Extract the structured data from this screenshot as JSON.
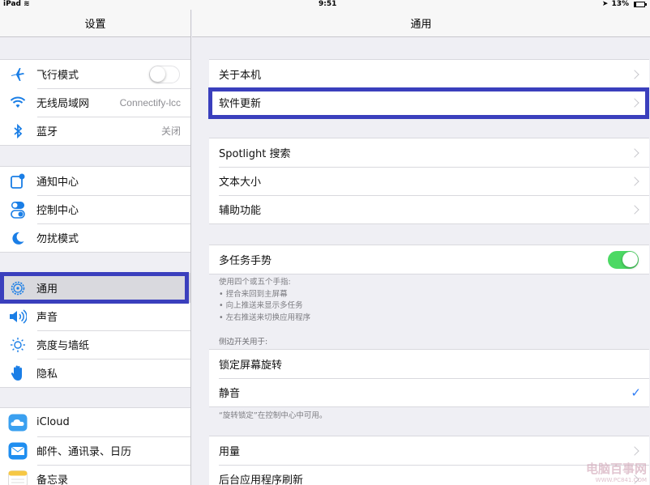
{
  "status_bar": {
    "device": "iPad",
    "time": "9:51",
    "battery": "13%"
  },
  "left": {
    "title": "设置",
    "groups": [
      [
        {
          "label": "飞行模式",
          "icon": "airplane-icon",
          "toggle": false
        },
        {
          "label": "无线局域网",
          "icon": "wifi-icon",
          "value": "Connectify-lcc"
        },
        {
          "label": "蓝牙",
          "icon": "bluetooth-icon",
          "value": "关闭"
        }
      ],
      [
        {
          "label": "通知中心",
          "icon": "notification-center-icon"
        },
        {
          "label": "控制中心",
          "icon": "control-center-icon"
        },
        {
          "label": "勿扰模式",
          "icon": "moon-icon"
        }
      ],
      [
        {
          "label": "通用",
          "icon": "gear-icon",
          "selected": true
        },
        {
          "label": "声音",
          "icon": "speaker-icon"
        },
        {
          "label": "亮度与墙纸",
          "icon": "sun-icon"
        },
        {
          "label": "隐私",
          "icon": "hand-icon"
        }
      ],
      [
        {
          "label": "iCloud",
          "icon": "cloud-icon"
        },
        {
          "label": "邮件、通讯录、日历",
          "icon": "mail-icon"
        },
        {
          "label": "备忘录",
          "icon": "notes-icon"
        }
      ]
    ]
  },
  "right": {
    "title": "通用",
    "group1": [
      "关于本机",
      "软件更新"
    ],
    "group2": [
      "Spotlight 搜索",
      "文本大小",
      "辅助功能"
    ],
    "multitask": {
      "label": "多任务手势",
      "on": true
    },
    "multitask_footer": [
      "使用四个或五个手指:",
      "• 捏合来回到主屏幕",
      "• 向上推送来显示多任务",
      "• 左右推送来切换应用程序"
    ],
    "side_switch_header": "侧边开关用于:",
    "side_switch": [
      "锁定屏幕旋转",
      "静音"
    ],
    "side_switch_checked": "✓",
    "side_switch_footer": "“旋转锁定”在控制中心中可用。",
    "group4": [
      "用量",
      "后台应用程序刷新"
    ]
  },
  "watermark": {
    "text": "电脑百事网",
    "url": "WWW.PC841.COM"
  },
  "colors": {
    "highlight": "#3a3fbd",
    "toggle_on": "#4cd964",
    "tint": "#2d7cf6"
  }
}
